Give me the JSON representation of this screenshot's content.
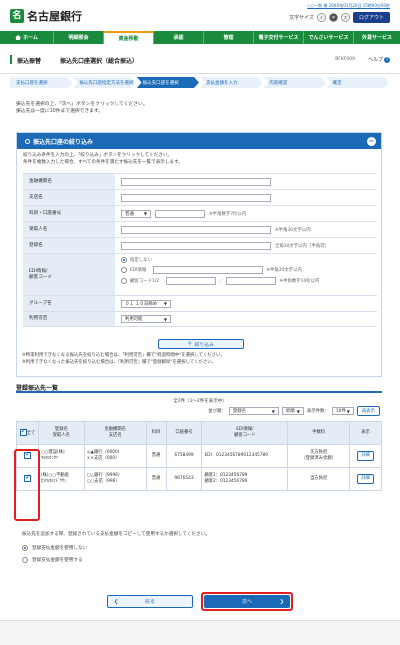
{
  "header": {
    "bank_name": "名古屋銀行",
    "logo_mark": "名",
    "user_line": "○○一郎 様 20XX年01月20日 15時00分00秒",
    "text_size_label": "文字サイズ",
    "sizes": [
      "小",
      "中",
      "大"
    ],
    "logout": "ログアウト"
  },
  "nav": {
    "home": "ホーム",
    "items": [
      "明細照会",
      "資金移動",
      "承認",
      "管理",
      "電子交付サービス",
      "でんさいサービス",
      "外貨サービス"
    ]
  },
  "title": {
    "t1": "振込振替",
    "t2": "振込先口座選択（総合振込）",
    "code": "BFKF009",
    "help": "ヘルプ",
    "help_icon": "?"
  },
  "steps": [
    "支払口座を選択",
    "振込先口座指定方法を選択",
    "振込先口座を選択",
    "支払金額を入力",
    "内容確認",
    "確定"
  ],
  "intro": [
    "振込先を選択の上、「次へ」ボタンをクリックしてください。",
    "振込先は一度に10件まで選択できます。"
  ],
  "filter": {
    "title": "振込先口座の絞り込み",
    "collapse": "−",
    "desc": [
      "絞り込み条件を入力の上、「絞り込み」ボタンをクリックしてください。",
      "条件を複数入力した場合、すべての条件を満たす振込先を一覧で表示します。"
    ],
    "labels": {
      "bank": "金融機関名",
      "branch": "支店名",
      "account": "科目・口座番号",
      "recipient": "受取人名",
      "reg_name": "登録名",
      "edi": "EDI情報/\n顧客コード",
      "group": "グループ名",
      "status": "利用可否"
    },
    "account_type": "普通",
    "account_note": "※半角数字7桁以内",
    "recipient_note": "※半角30文字以内",
    "reg_note": "全角30文字以内［半角可］",
    "edi_opts": [
      "指定しない",
      "EDI情報",
      "顧客コード1/2"
    ],
    "edi_note": "※半角20文字以内",
    "code_note": "※半角数字10桁以内",
    "slash": "／",
    "group": "０１ １０日締め",
    "status": "利用可能",
    "button": "絞り込み",
    "notes": [
      "※特来利用できなくなる振込先を絞り込む場合は、「利用可否」欄で\"経過時間中\"を選択してください。",
      "※利用できなくなった振込先を絞り込む場合は、「利用可否」欄で\"登録解除\"を選択してください。"
    ]
  },
  "list": {
    "title": "登録振込先一覧",
    "count": "全2件（1〜2件を表示中）",
    "sort_label": "並び順：",
    "sort_value": "登録名",
    "order": "昇順",
    "per_label": "表示件数：",
    "per_value": "10件",
    "redisplay": "再表示",
    "headers": [
      "全て",
      "登録名\n受取人名",
      "金融機関名\n支店名",
      "科目",
      "口座番号",
      "EDI情報/\n顧客コード",
      "手数料",
      "表示"
    ],
    "rows": [
      {
        "name": "○○建設(株)",
        "kana": "ﾏﾙﾏﾙｹﾝｾﾂ",
        "bank": "◎▲銀行（0000）",
        "branch": "××支店（000）",
        "type": "普通",
        "num": "6758499",
        "edi": "EDI：0123456789012345789",
        "fee": "先方負担\n（登録済み金額）",
        "detail": "詳細"
      },
      {
        "name": "(株)○○不動産",
        "kana": "ｶ)ﾏﾙﾏﾙﾌﾄﾞｳｻﾝ",
        "bank": "□△銀行（9996）",
        "branch": "○○支店（996）",
        "type": "普通",
        "num": "9876543",
        "edi": "顧客1：0123456789\n顧客2：0123456789",
        "fee": "当方負担",
        "detail": "詳細"
      }
    ]
  },
  "add": {
    "desc": "振込先を追加する際、登録されている支払金額をコピーして使用するか選択してください。",
    "opts": [
      "登録支払金額を使用しない",
      "登録支払金額を使用する"
    ]
  },
  "buttons": {
    "back": "戻る",
    "next": "次へ"
  },
  "colors": {
    "brand_green": "#1a8a3c",
    "accent_blue": "#1a6ab8",
    "highlight_red": "#e02020"
  }
}
